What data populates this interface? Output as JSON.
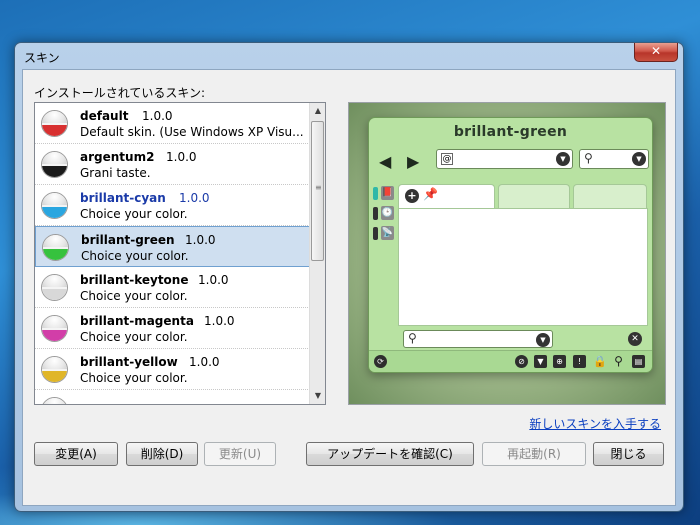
{
  "dialog": {
    "title": "スキン",
    "close_glyph": "✕",
    "installed_label": "インストールされているスキン:",
    "get_more_link": "新しいスキンを入手する"
  },
  "skins": [
    {
      "name": "default",
      "version": "1.0.0",
      "desc": "Default skin. (Use Windows XP Visu...",
      "color": "#d83030",
      "highlight": false
    },
    {
      "name": "argentum2",
      "version": "1.0.0",
      "desc": "Grani taste.",
      "color": "#1a1a1a",
      "highlight": false
    },
    {
      "name": "brillant-cyan",
      "version": "1.0.0",
      "desc": "Choice your color.",
      "color": "#2aa6e0",
      "highlight": true
    },
    {
      "name": "brillant-green",
      "version": "1.0.0",
      "desc": "Choice your color.",
      "color": "#36c23e",
      "highlight": false,
      "selected": true
    },
    {
      "name": "brillant-keytone",
      "version": "1.0.0",
      "desc": "Choice your color.",
      "color": "#d8d8d8",
      "highlight": false
    },
    {
      "name": "brillant-magenta",
      "version": "1.0.0",
      "desc": "Choice your color.",
      "color": "#d23ea8",
      "highlight": false
    },
    {
      "name": "brillant-yellow",
      "version": "1.0.0",
      "desc": "Choice your color.",
      "color": "#e0b628",
      "highlight": false
    }
  ],
  "scrollbar": {
    "up": "▲",
    "down": "▼",
    "grip": "≡"
  },
  "preview": {
    "title": "brillant-green",
    "back_glyph": "◀",
    "forward_glyph": "▶",
    "at_glyph": "@",
    "dropdown_glyph": "▼",
    "search_glyph": "⚲",
    "plus_glyph": "+",
    "pin_glyph": "📌",
    "clear_glyph": "✕",
    "side_icons": [
      "📕",
      "🕒",
      "📡"
    ],
    "status_icons": [
      "⟳",
      "⊘",
      "▼",
      "⊕",
      "!",
      "🔒",
      "⚲",
      "▤"
    ]
  },
  "buttons": [
    {
      "label": "変更(A)",
      "disabled": false
    },
    {
      "label": "削除(D)",
      "disabled": false
    },
    {
      "label": "更新(U)",
      "disabled": true
    },
    {
      "label": "アップデートを確認(C)",
      "disabled": false
    },
    {
      "label": "再起動(R)",
      "disabled": true
    },
    {
      "label": "閉じる",
      "disabled": false
    }
  ]
}
